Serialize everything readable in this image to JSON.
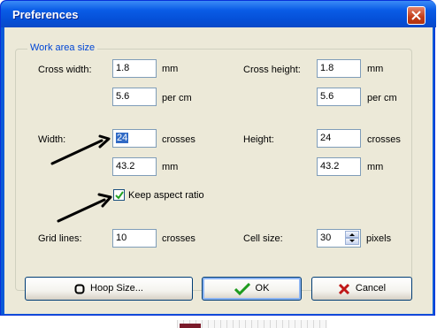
{
  "window": {
    "title": "Preferences"
  },
  "group": {
    "label": "Work area size"
  },
  "cross_width": {
    "label": "Cross width:",
    "value": "1.8",
    "unit": "mm",
    "per_value": "5.6",
    "per_unit": "per cm"
  },
  "cross_height": {
    "label": "Cross height:",
    "value": "1.8",
    "unit": "mm",
    "per_value": "5.6",
    "per_unit": "per cm"
  },
  "width": {
    "label": "Width:",
    "value": "24",
    "unit": "crosses",
    "mm_value": "43.2",
    "mm_unit": "mm"
  },
  "height": {
    "label": "Height:",
    "value": "24",
    "unit": "crosses",
    "mm_value": "43.2",
    "mm_unit": "mm"
  },
  "keep_aspect": {
    "label": "Keep aspect ratio",
    "checked": true
  },
  "grid_lines": {
    "label": "Grid lines:",
    "value": "10",
    "unit": "crosses"
  },
  "cell_size": {
    "label": "Cell size:",
    "value": "30",
    "unit": "pixels"
  },
  "buttons": {
    "hoop": "Hoop Size...",
    "ok": "OK",
    "cancel": "Cancel"
  }
}
